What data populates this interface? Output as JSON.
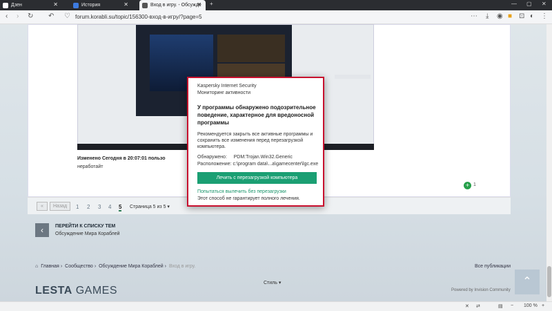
{
  "tabs": [
    {
      "label": "Дзен",
      "active": false
    },
    {
      "label": "История",
      "active": false
    },
    {
      "label": "Вход в игру. - Обсужде",
      "active": true
    }
  ],
  "window": {
    "minimize": "—",
    "maximize": "▢",
    "close": "✕"
  },
  "address": {
    "url": "forum.korabli.su/topic/156300-вход-в-игру/?page=5"
  },
  "post": {
    "edited_label": "Изменено Сегодня в 20:07:01 пользо",
    "message": "неработайт",
    "like_count": "1"
  },
  "pagination": {
    "back_label": "Назад",
    "pages": [
      "1",
      "2",
      "3",
      "4",
      "5"
    ],
    "current": "5",
    "page_of": "Страница 5 из 5 ▾"
  },
  "back_to_list": {
    "title": "ПЕРЕЙТИ К СПИСКУ ТЕМ",
    "subtitle": "Обсуждение Мира Кораблей"
  },
  "breadcrumbs": [
    "Главная",
    "Сообщество",
    "Обсуждение Мира Кораблей",
    "Вход в игру."
  ],
  "all_pubs": "Все публикации",
  "footer": {
    "logo_bold": "LESTA",
    "logo_light": " GAMES",
    "style": "Стиль ▾",
    "powered": "Powered by Invision Community"
  },
  "status": {
    "zoom": "100 %"
  },
  "kaspersky": {
    "app": "Kaspersky Internet Security",
    "subtitle": "Мониторинг активности",
    "heading": "У программы обнаружено подозрительное поведение, характерное для вредоносной программы",
    "body": "Рекомендуется закрыть все активные программы и сохранить все изменения перед перезагрузкой компьютера.",
    "detected": "Обнаружено:     PDM:Trojan.Win32.Generic",
    "location": "Расположение: c:\\program data\\...a\\gamecenter\\lgc.exe",
    "cta": "Лечить с перезагрузкой компьютера",
    "link": "Попытаться вылечить без перезагрузки",
    "note": "Этот способ не гарантирует полного лечения."
  },
  "colors": {
    "accent": "#1b9f73",
    "alert_border": "#c8102e",
    "tabbar": "#2b2d31"
  }
}
